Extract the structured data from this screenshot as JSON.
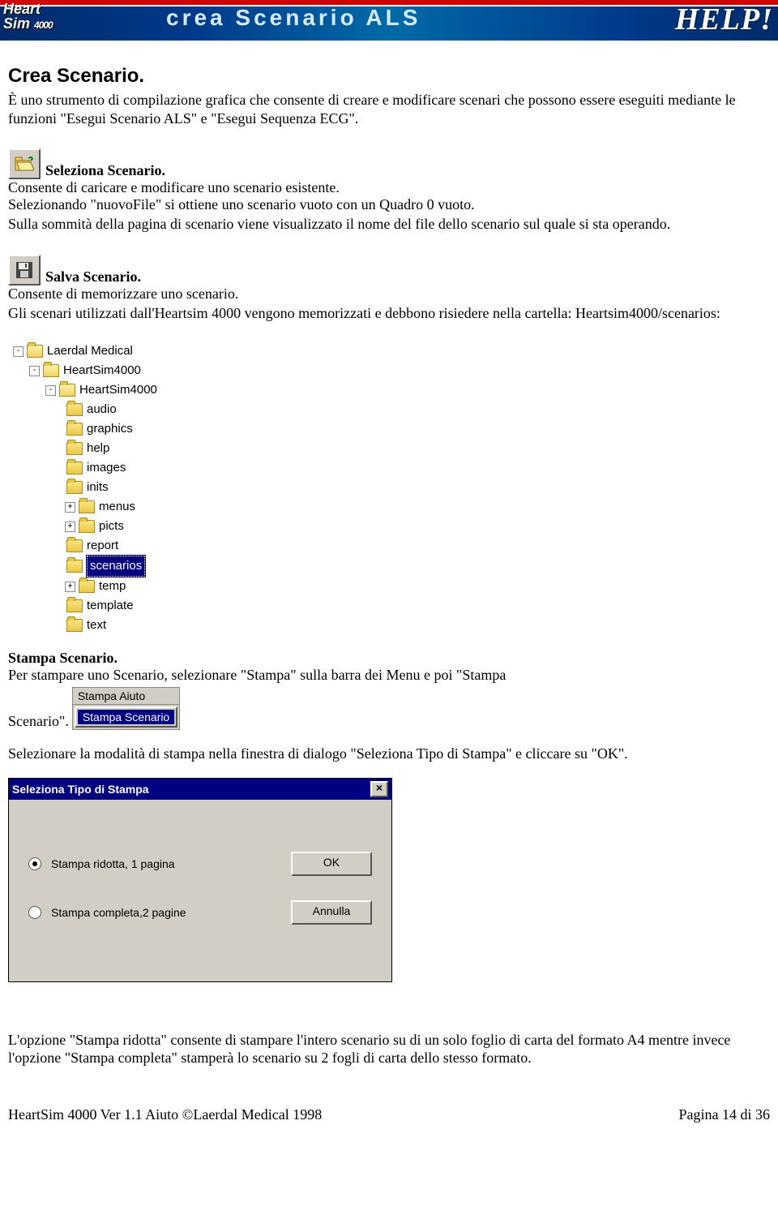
{
  "banner": {
    "logo_line1": "Heart",
    "logo_line2": "Sim",
    "logo_model": "4000",
    "title": "crea Scenario ALS",
    "help": "HELP!"
  },
  "heading": "Crea Scenario.",
  "intro": "È uno strumento di compilazione grafica che consente di creare e modificare scenari che possono essere eseguiti mediante le funzioni \"Esegui Scenario ALS\" e \"Esegui Sequenza ECG\".",
  "seleziona": {
    "title": "Seleziona Scenario.",
    "p1": "Consente di caricare e modificare uno scenario esistente.",
    "p2": "Selezionando \"nuovoFile\" si ottiene uno scenario vuoto con un Quadro 0 vuoto.",
    "p3": "Sulla sommità della pagina di scenario viene visualizzato il nome del file dello scenario sul quale si sta operando."
  },
  "salva": {
    "title": "Salva Scenario.",
    "p1": "Consente di memorizzare uno scenario.",
    "p2": "Gli scenari utilizzati dall'Heartsim 4000 vengono memorizzati e debbono risiedere nella cartella: Heartsim4000/scenarios:"
  },
  "tree": {
    "root": "Laerdal Medical",
    "l1": "HeartSim4000",
    "l2": "HeartSim4000",
    "items": [
      "audio",
      "graphics",
      "help",
      "images",
      "inits",
      "menus",
      "picts",
      "report",
      "scenarios",
      "temp",
      "template",
      "text"
    ]
  },
  "stampa": {
    "title": "Stampa Scenario.",
    "p1": "Per stampare uno Scenario, selezionare \"Stampa\" sulla barra dei Menu e poi \"Stampa",
    "trail": "Scenario\".",
    "menubar": "Stampa  Aiuto",
    "menuitem": "Stampa Scenario",
    "p2": "Selezionare la modalità di stampa nella finestra di dialogo \"Seleziona Tipo di Stampa\" e cliccare su \"OK\"."
  },
  "dialog": {
    "title": "Seleziona Tipo di Stampa",
    "opt1": "Stampa ridotta, 1 pagina",
    "opt2": "Stampa completa,2 pagine",
    "ok": "OK",
    "cancel": "Annulla"
  },
  "closing": "L'opzione \"Stampa ridotta\" consente di stampare l'intero scenario su di un solo foglio di carta del formato A4 mentre invece l'opzione \"Stampa completa\" stamperà lo scenario su 2 fogli di carta dello stesso formato.",
  "footer": {
    "left": "HeartSim 4000 Ver 1.1 Aiuto   ©Laerdal Medical  1998",
    "right": "Pagina 14 di 36"
  }
}
